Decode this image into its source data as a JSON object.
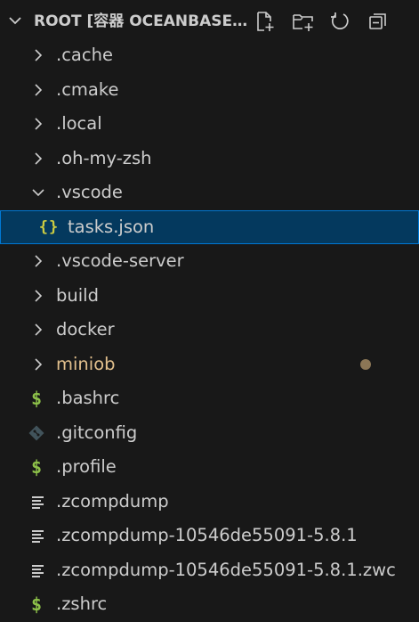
{
  "colors": {
    "background": "#181818",
    "selected_bg": "#04395e",
    "selected_border": "#0078d4",
    "text": "#cccccc",
    "modified_text": "#e2c08d",
    "modified_dot": "#8b7656",
    "json_icon": "#cbcb41",
    "shell_icon": "#8dc149",
    "git_icon": "#41535b"
  },
  "header": {
    "title": "ROOT [容器 OCEANBASE...",
    "actions": [
      "new-file-icon",
      "new-folder-icon",
      "refresh-icon",
      "collapse-all-icon"
    ]
  },
  "tree": {
    "items": [
      {
        "label": ".cache",
        "kind": "folder",
        "expanded": false
      },
      {
        "label": ".cmake",
        "kind": "folder",
        "expanded": false
      },
      {
        "label": ".local",
        "kind": "folder",
        "expanded": false
      },
      {
        "label": ".oh-my-zsh",
        "kind": "folder",
        "expanded": false
      },
      {
        "label": ".vscode",
        "kind": "folder",
        "expanded": true
      },
      {
        "label": "tasks.json",
        "kind": "file",
        "icon": "json-braces-icon",
        "icon_text": "{}",
        "selected": true
      },
      {
        "label": ".vscode-server",
        "kind": "folder",
        "expanded": false
      },
      {
        "label": "build",
        "kind": "folder",
        "expanded": false
      },
      {
        "label": "docker",
        "kind": "folder",
        "expanded": false
      },
      {
        "label": "miniob",
        "kind": "folder",
        "expanded": false,
        "modified": true
      },
      {
        "label": ".bashrc",
        "kind": "file",
        "icon": "shell-dollar-icon",
        "icon_text": "$"
      },
      {
        "label": ".gitconfig",
        "kind": "file",
        "icon": "git-diamond-icon"
      },
      {
        "label": ".profile",
        "kind": "file",
        "icon": "shell-dollar-icon",
        "icon_text": "$"
      },
      {
        "label": ".zcompdump",
        "kind": "file",
        "icon": "text-lines-icon"
      },
      {
        "label": ".zcompdump-10546de55091-5.8.1",
        "kind": "file",
        "icon": "text-lines-icon"
      },
      {
        "label": ".zcompdump-10546de55091-5.8.1.zwc",
        "kind": "file",
        "icon": "text-lines-icon"
      },
      {
        "label": ".zshrc",
        "kind": "file",
        "icon": "shell-dollar-icon",
        "icon_text": "$"
      }
    ]
  }
}
